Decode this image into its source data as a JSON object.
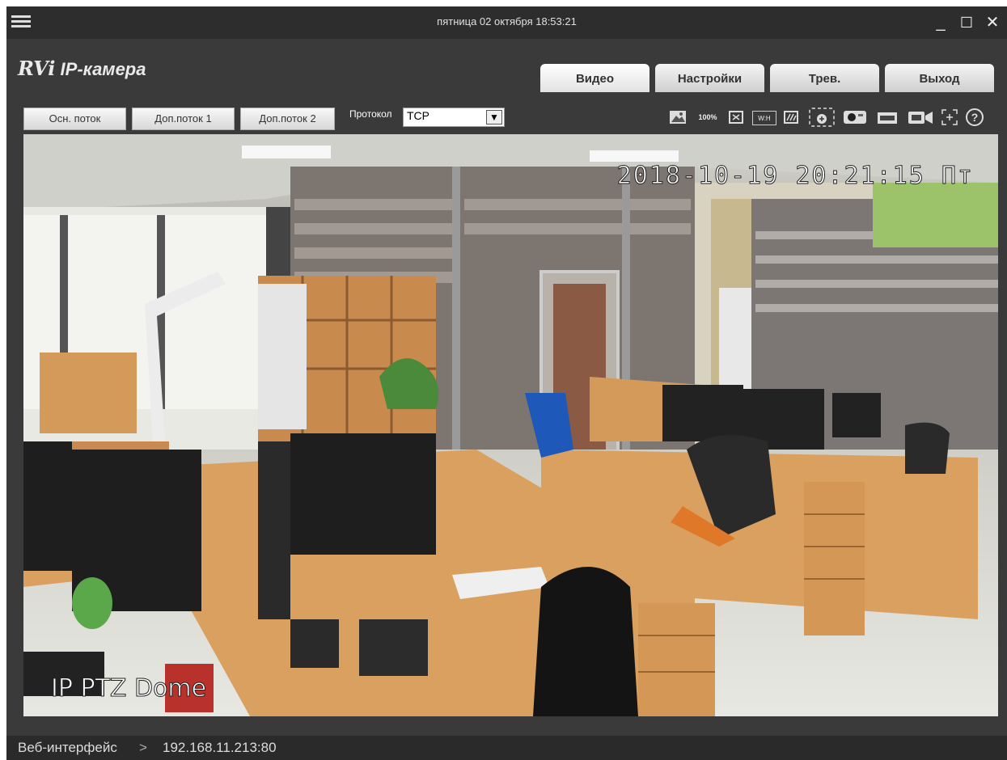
{
  "titlebar": {
    "datetime": "пятница 02 октября 18:53:21",
    "minimize": "_",
    "maximize": "☐",
    "close": "✕"
  },
  "header": {
    "logo_brand": "RVi",
    "logo_text": "IP-камера"
  },
  "tabs": [
    {
      "label": "Видео",
      "active": true
    },
    {
      "label": "Настройки",
      "active": false
    },
    {
      "label": "Трев.",
      "active": false
    },
    {
      "label": "Выход",
      "active": false
    }
  ],
  "streams": {
    "main": "Осн. поток",
    "sub1": "Доп.поток 1",
    "sub2": "Доп.поток 2"
  },
  "protocol": {
    "label": "Протокол",
    "value": "TCP"
  },
  "toolbar_icons": {
    "zoom_100": "100%",
    "ratio": "W:H",
    "help": "?"
  },
  "video": {
    "osd_timestamp": "2018-10-19 20:21:15 Пт",
    "osd_camera_name": "IP PTZ Dome"
  },
  "statusbar": {
    "breadcrumb": "Веб-интерфейс",
    "separator": ">",
    "address": "192.168.11.213:80"
  },
  "colors": {
    "window_bg": "#3a3a3a",
    "titlebar_bg": "#2d2d2d",
    "statusbar_bg": "#2a2a2a"
  }
}
